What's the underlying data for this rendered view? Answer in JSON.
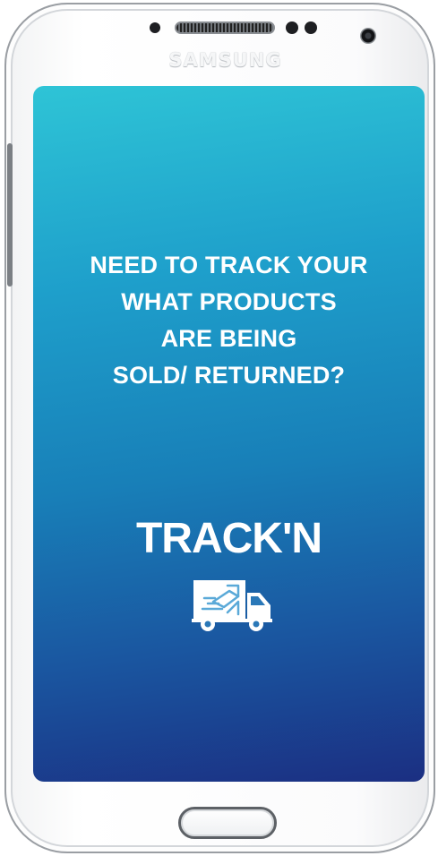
{
  "device": {
    "brand": "SAMSUNG",
    "body_color": "#f7f8f9",
    "bezel_color": "#9a9ea3"
  },
  "screen": {
    "gradient_top": "#2ec4d6",
    "gradient_bottom": "#1b2f82",
    "headline": [
      "NEED TO TRACK YOUR",
      "WHAT PRODUCTS",
      "ARE BEING",
      "SOLD/ RETURNED?"
    ],
    "logo": {
      "text": "TRACK'N",
      "icon": "delivery-truck-icon"
    }
  }
}
